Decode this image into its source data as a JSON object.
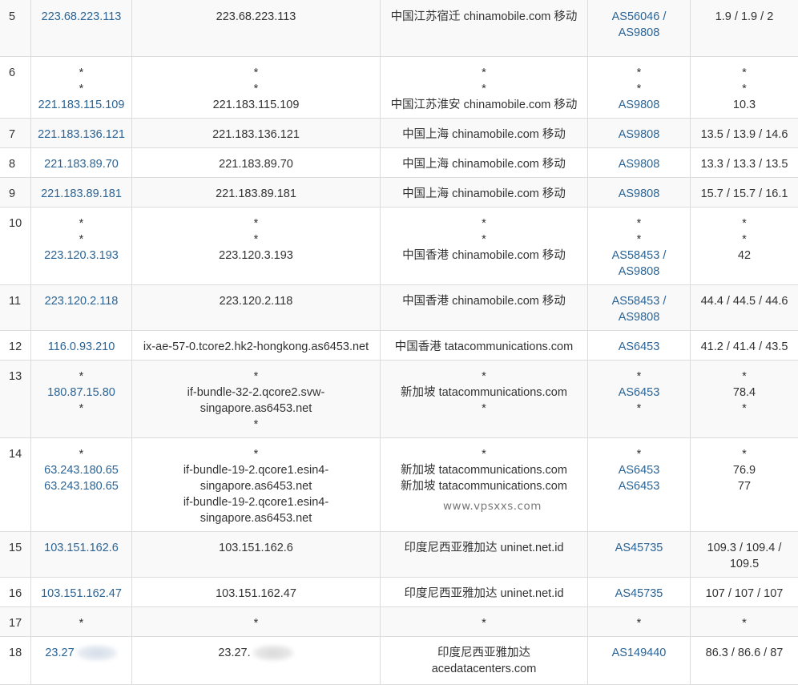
{
  "rows": [
    {
      "hop": "5",
      "ip": [
        "223.68.223.113"
      ],
      "host": [
        "223.68.223.113"
      ],
      "loc": [
        "中国江苏宿迁 chinamobile.com 移动"
      ],
      "asn": [
        "AS56046 /",
        "AS9808"
      ],
      "asn_link": [
        true,
        true
      ],
      "rtt": [
        "1.9 / 1.9 / 2"
      ],
      "h": 70
    },
    {
      "hop": "6",
      "ip": [
        "*",
        "*",
        "221.183.115.109"
      ],
      "host": [
        "*",
        "*",
        "221.183.115.109"
      ],
      "loc": [
        "*",
        "*",
        "中国江苏淮安 chinamobile.com 移动"
      ],
      "asn": [
        "*",
        "*",
        "AS9808"
      ],
      "asn_link": [
        false,
        false,
        true
      ],
      "rtt": [
        "*",
        "*",
        "10.3"
      ],
      "h": 77
    },
    {
      "hop": "7",
      "ip": [
        "221.183.136.121"
      ],
      "host": [
        "221.183.136.121"
      ],
      "loc": [
        "中国上海 chinamobile.com 移动"
      ],
      "asn": [
        "AS9808"
      ],
      "asn_link": [
        true
      ],
      "rtt": [
        "13.5 / 13.9 / 14.6"
      ],
      "h": 37
    },
    {
      "hop": "8",
      "ip": [
        "221.183.89.70"
      ],
      "host": [
        "221.183.89.70"
      ],
      "loc": [
        "中国上海 chinamobile.com 移动"
      ],
      "asn": [
        "AS9808"
      ],
      "asn_link": [
        true
      ],
      "rtt": [
        "13.3 / 13.3 / 13.5"
      ],
      "h": 37
    },
    {
      "hop": "9",
      "ip": [
        "221.183.89.181"
      ],
      "host": [
        "221.183.89.181"
      ],
      "loc": [
        "中国上海 chinamobile.com 移动"
      ],
      "asn": [
        "AS9808"
      ],
      "asn_link": [
        true
      ],
      "rtt": [
        "15.7 / 15.7 / 16.1"
      ],
      "h": 37
    },
    {
      "hop": "10",
      "ip": [
        "*",
        "*",
        "223.120.3.193"
      ],
      "host": [
        "*",
        "*",
        "223.120.3.193"
      ],
      "loc": [
        "*",
        "*",
        "中国香港 chinamobile.com 移动"
      ],
      "asn": [
        "*",
        "*",
        "AS58453 /",
        "AS9808"
      ],
      "asn_link": [
        false,
        false,
        true,
        true
      ],
      "rtt": [
        "*",
        "*",
        "42"
      ],
      "h": 97
    },
    {
      "hop": "11",
      "ip": [
        "223.120.2.118"
      ],
      "host": [
        "223.120.2.118"
      ],
      "loc": [
        "中国香港 chinamobile.com 移动"
      ],
      "asn": [
        "AS58453 /",
        "AS9808"
      ],
      "asn_link": [
        true,
        true
      ],
      "rtt": [
        "44.4 / 44.5 / 44.6"
      ],
      "h": 57
    },
    {
      "hop": "12",
      "ip": [
        "116.0.93.210"
      ],
      "host": [
        "ix-ae-57-0.tcore2.hk2-hongkong.as6453.net"
      ],
      "loc": [
        "中国香港 tatacommunications.com"
      ],
      "asn": [
        "AS6453"
      ],
      "asn_link": [
        true
      ],
      "rtt": [
        "41.2 / 41.4 / 43.5"
      ],
      "h": 37
    },
    {
      "hop": "13",
      "ip": [
        "*",
        "180.87.15.80",
        "*"
      ],
      "host": [
        "*",
        "if-bundle-32-2.qcore2.svw-",
        "singapore.as6453.net",
        "*"
      ],
      "loc": [
        "*",
        "新加坡 tatacommunications.com",
        "*"
      ],
      "asn": [
        "*",
        "AS6453",
        "*"
      ],
      "asn_link": [
        false,
        true,
        false
      ],
      "rtt": [
        "*",
        "78.4",
        "*"
      ],
      "h": 97
    },
    {
      "hop": "14",
      "ip": [
        "*",
        "63.243.180.65",
        "63.243.180.65"
      ],
      "host": [
        "*",
        "if-bundle-19-2.qcore1.esin4-",
        "singapore.as6453.net",
        "if-bundle-19-2.qcore1.esin4-",
        "singapore.as6453.net"
      ],
      "loc": [
        "*",
        "新加坡 tatacommunications.com",
        "新加坡 tatacommunications.com"
      ],
      "asn": [
        "*",
        "AS6453",
        "AS6453"
      ],
      "asn_link": [
        false,
        true,
        true
      ],
      "rtt": [
        "*",
        "76.9",
        "77"
      ],
      "h": 117
    },
    {
      "hop": "15",
      "ip": [
        "103.151.162.6"
      ],
      "host": [
        "103.151.162.6"
      ],
      "loc": [
        "印度尼西亚雅加达 uninet.net.id"
      ],
      "asn": [
        "AS45735"
      ],
      "asn_link": [
        true
      ],
      "rtt": [
        "109.3 / 109.4 /",
        "109.5"
      ],
      "h": 57
    },
    {
      "hop": "16",
      "ip": [
        "103.151.162.47"
      ],
      "host": [
        "103.151.162.47"
      ],
      "loc": [
        "印度尼西亚雅加达 uninet.net.id"
      ],
      "asn": [
        "AS45735"
      ],
      "asn_link": [
        true
      ],
      "rtt": [
        "107 / 107 / 107"
      ],
      "h": 37
    },
    {
      "hop": "17",
      "ip": [
        "*"
      ],
      "host": [
        "*"
      ],
      "loc": [
        "*"
      ],
      "asn": [
        "*"
      ],
      "asn_link": [
        false
      ],
      "rtt": [
        "*"
      ],
      "h": 37
    },
    {
      "hop": "18",
      "ip": [
        "23.27"
      ],
      "host": [
        "23.27."
      ],
      "loc": [
        "印度尼西亚雅加达",
        "acedatacenters.com"
      ],
      "asn": [
        "AS149440"
      ],
      "asn_link": [
        true
      ],
      "rtt": [
        "86.3 / 86.6 / 87"
      ],
      "h": 60,
      "redacted": true
    }
  ],
  "watermark": "www.vpsxxs.com"
}
